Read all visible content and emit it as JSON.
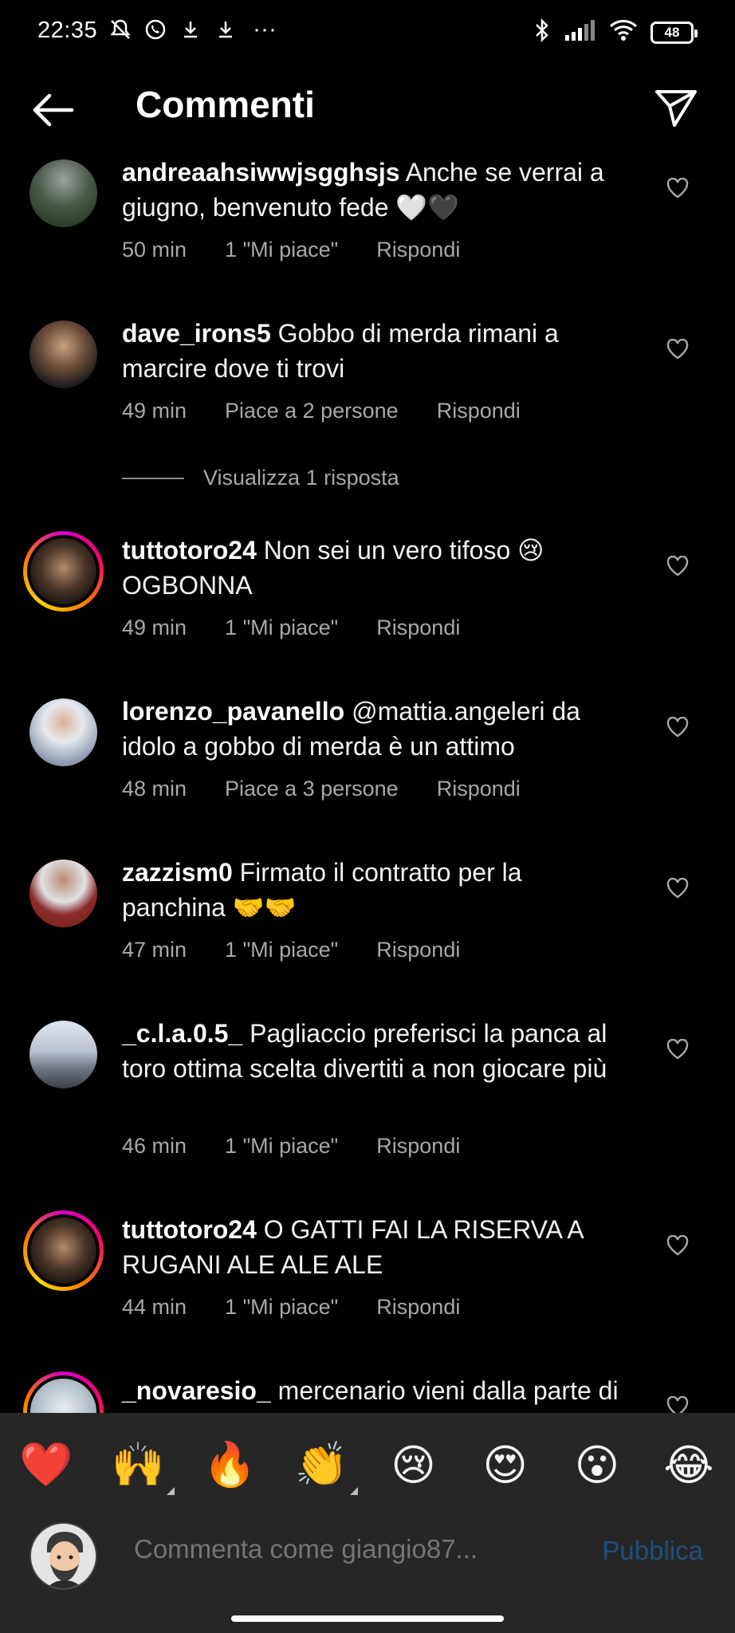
{
  "status": {
    "time": "22:35",
    "battery": "48",
    "more": "···"
  },
  "header": {
    "title": "Commenti"
  },
  "comments": [
    {
      "username": "andreaahsiwwjsgghsjs",
      "text": "Anche se verrai a giugno, benvenuto fede 🤍🖤",
      "time": "50 min",
      "likes": "1 \"Mi piace\"",
      "reply": "Rispondi",
      "avatar_color": "#3c4a3a"
    },
    {
      "username": "dave_irons5",
      "text": "Gobbo di merda rimani a marcire dove ti trovi",
      "time": "49 min",
      "likes": "Piace a 2 persone",
      "reply": "Rispondi",
      "avatar_color": "#6a5242",
      "view_replies": "Visualizza 1 risposta"
    },
    {
      "username": "tuttotoro24",
      "text": "Non sei un vero tifoso 😢 OGBONNA",
      "time": "49 min",
      "likes": "1 \"Mi piace\"",
      "reply": "Rispondi",
      "avatar_color": "#3a2f2a"
    },
    {
      "username": "lorenzo_pavanello",
      "text": "@mattia.angeleri da idolo a gobbo di merda è un attimo",
      "time": "48 min",
      "likes": "Piace a 3 persone",
      "reply": "Rispondi",
      "avatar_color": "#a7b4c4"
    },
    {
      "username": "zazzism0",
      "text": "Firmato il contratto per la panchina 🤝🤝",
      "time": "47 min",
      "likes": "1 \"Mi piace\"",
      "reply": "Rispondi",
      "avatar_color": "#8b2b2b"
    },
    {
      "username": "_c.l.a.0.5_",
      "text": "Pagliaccio preferisci la panca al toro ottima scelta divertiti a non giocare più",
      "time": "46 min",
      "likes": "1 \"Mi piace\"",
      "reply": "Rispondi",
      "avatar_color": "#9aa3ad"
    },
    {
      "username": "tuttotoro24",
      "text": "O GATTI FAI LA RISERVA A RUGANI ALE ALE ALE",
      "time": "44 min",
      "likes": "1 \"Mi piace\"",
      "reply": "Rispondi",
      "avatar_color": "#3a2f2a"
    },
    {
      "username": "_novaresio_",
      "text": "mercenario vieni dalla parte di torino",
      "time": "",
      "likes": "",
      "reply": "",
      "avatar_color": "#c9d2d8"
    }
  ],
  "emojis": [
    "❤️",
    "🙌",
    "🔥",
    "👏",
    "😢",
    "😍",
    "😮",
    "😂"
  ],
  "composer": {
    "placeholder": "Commenta come giangio87...",
    "publish_label": "Pubblica"
  }
}
